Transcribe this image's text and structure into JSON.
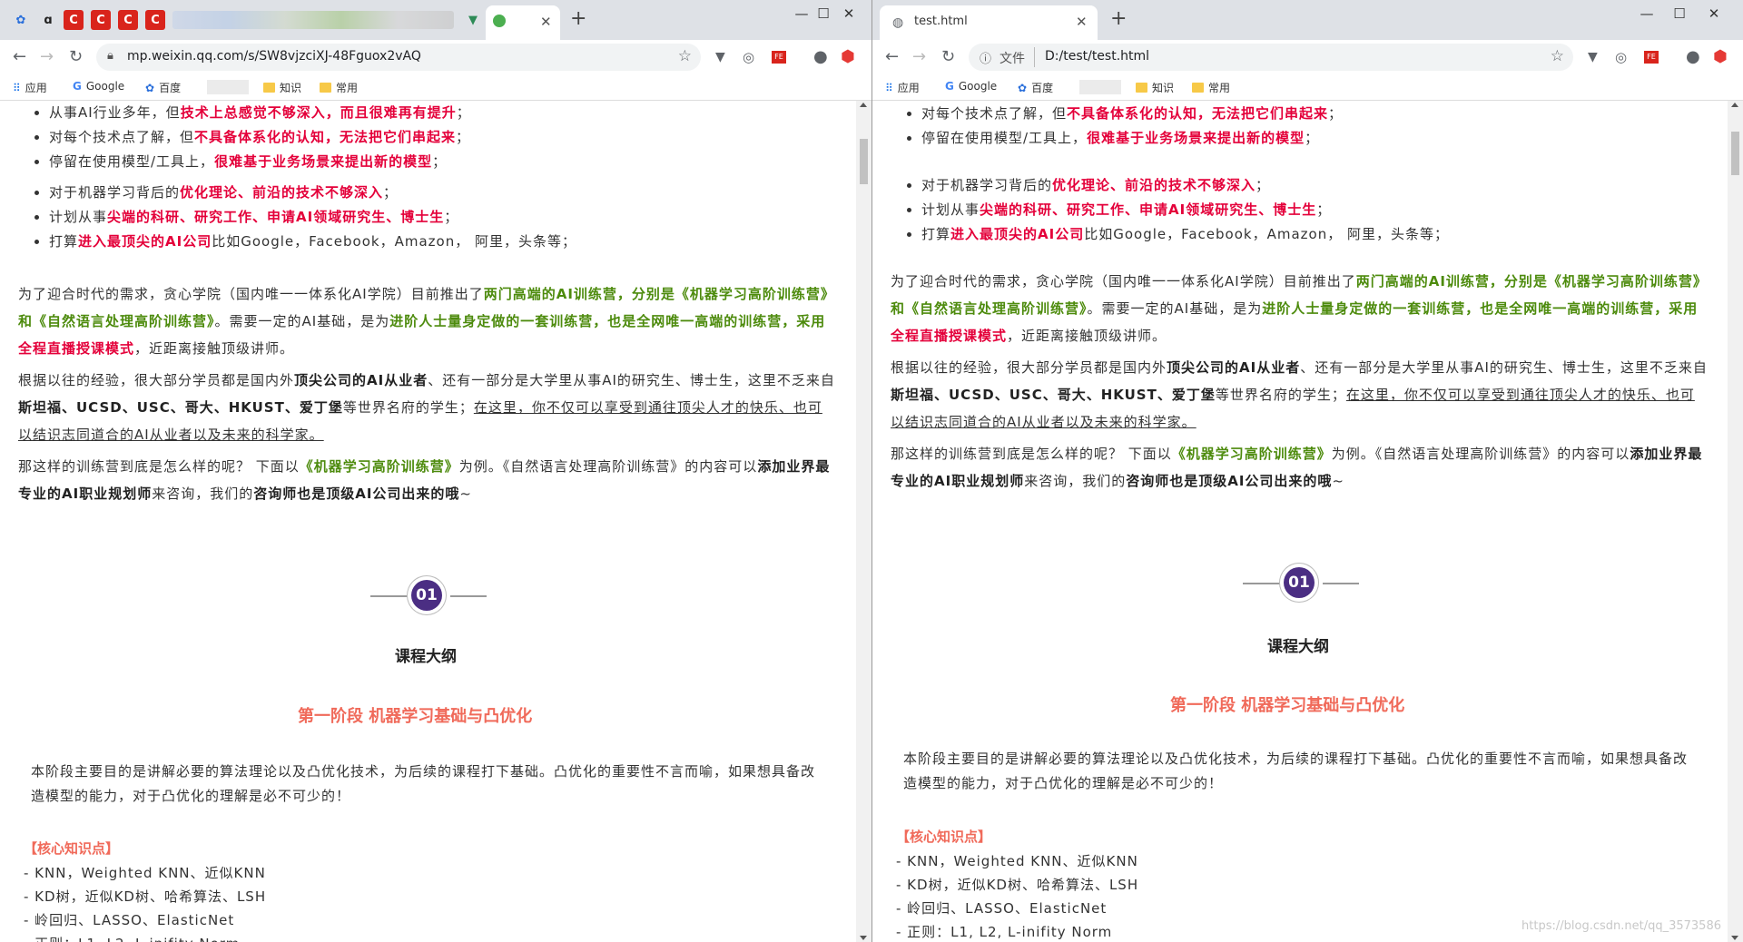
{
  "left": {
    "url": "mp.weixin.qq.com/s/SW8vjzciXJ-48Fguox2vAQ"
  },
  "right": {
    "tab_title": "test.html",
    "url_prefix": "文件",
    "url": "D:/test/test.html"
  },
  "bookmarks": {
    "apps": "应用",
    "google": "Google",
    "baidu": "百度",
    "zhishi": "知识",
    "changyong": "常用"
  },
  "article": {
    "bullets1": [
      {
        "plain": "从事AI行业多年，但",
        "hl": "技术上总感觉不够深入，而且很难再有提升",
        "tail": "；"
      },
      {
        "plain": "对每个技术点了解，但",
        "hl": "不具备体系化的认知，无法把它们串起来",
        "tail": "；"
      },
      {
        "plain": "停留在使用模型/工具上，",
        "hl": "很难基于业务场景来提出新的模型",
        "tail": "；"
      }
    ],
    "bullets2": [
      {
        "plain": "对于机器学习背后的",
        "hl": "优化理论、前沿的技术不够深入",
        "tail": "；"
      },
      {
        "plain": "计划从事",
        "hl": "尖端的科研、研究工作、申请AI领域研究生、博士生",
        "tail": "；"
      },
      {
        "plain": "打算",
        "hl": "进入最顶尖的AI公司",
        "tail": "比如Google，Facebook，Amazon， 阿里，头条等；"
      }
    ],
    "p1_a": "为了迎合时代的需求，贪心学院（国内唯一一体系化AI学院）目前推出了",
    "p1_g1": "两门高端的AI训练营，分别是《机器学习高阶训练营》和《自然语言处理高阶训练营》",
    "p1_b": "。需要一定的AI基础，是为",
    "p1_g2": "进阶人士量身定做的一套训练营，也是全网唯一高端的训练营，采用",
    "p1_r": "全程直播授课模式",
    "p1_c": "，近距离接触顶级讲师。",
    "p2_a": "根据以往的经验，很大部分学员都是国内外",
    "p2_b1": "顶尖公司的AI从业者",
    "p2_c": "、还有一部分是大学里从事AI的研究生、博士生，这里不乏来自",
    "p2_b2": "斯坦福、UCSD、USC、哥大、HKUST、爱丁堡",
    "p2_d": "等世界名府的学生；",
    "p2_u": "在这里，你不仅可以享受到通往顶尖人才的快乐、也可以结识志同道合的AI从业者以及未来的科学家。",
    "p3_a": "那这样的训练营到底是怎么样的呢？ 下面以",
    "p3_g": "《机器学习高阶训练营》",
    "p3_b": "为例。《自然语言处理高阶训练营》的内容可以",
    "p3_b1": "添加业界最专业的AI职业规划师",
    "p3_c": "来咨询，我们的",
    "p3_b2": "咨询师也是顶级AI公司出来的哦",
    "p3_d": "~",
    "badge": "01",
    "outline": "课程大纲",
    "phase1": "第一阶段 机器学习基础与凸优化",
    "intro": "本阶段主要目的是讲解必要的算法理论以及凸优化技术，为后续的课程打下基础。凸优化的重要性不言而喻，如果想具备改造模型的能力，对于凸优化的理解是必不可少的！",
    "core": "【核心知识点】",
    "kps": [
      "- KNN，Weighted KNN、近似KNN",
      "- KD树，近似KD树、哈希算法、LSH",
      "- 岭回归、LASSO、ElasticNet",
      "- 正则：L1, L2, L-inifity Norm"
    ]
  },
  "watermark": "https://blog.csdn.net/qq_3573586",
  "colors": {
    "highlight_red": "#e4003a",
    "highlight_green": "#4d8b0d",
    "phase_orange": "#f06a5a",
    "badge_purple": "#4b2e83"
  }
}
